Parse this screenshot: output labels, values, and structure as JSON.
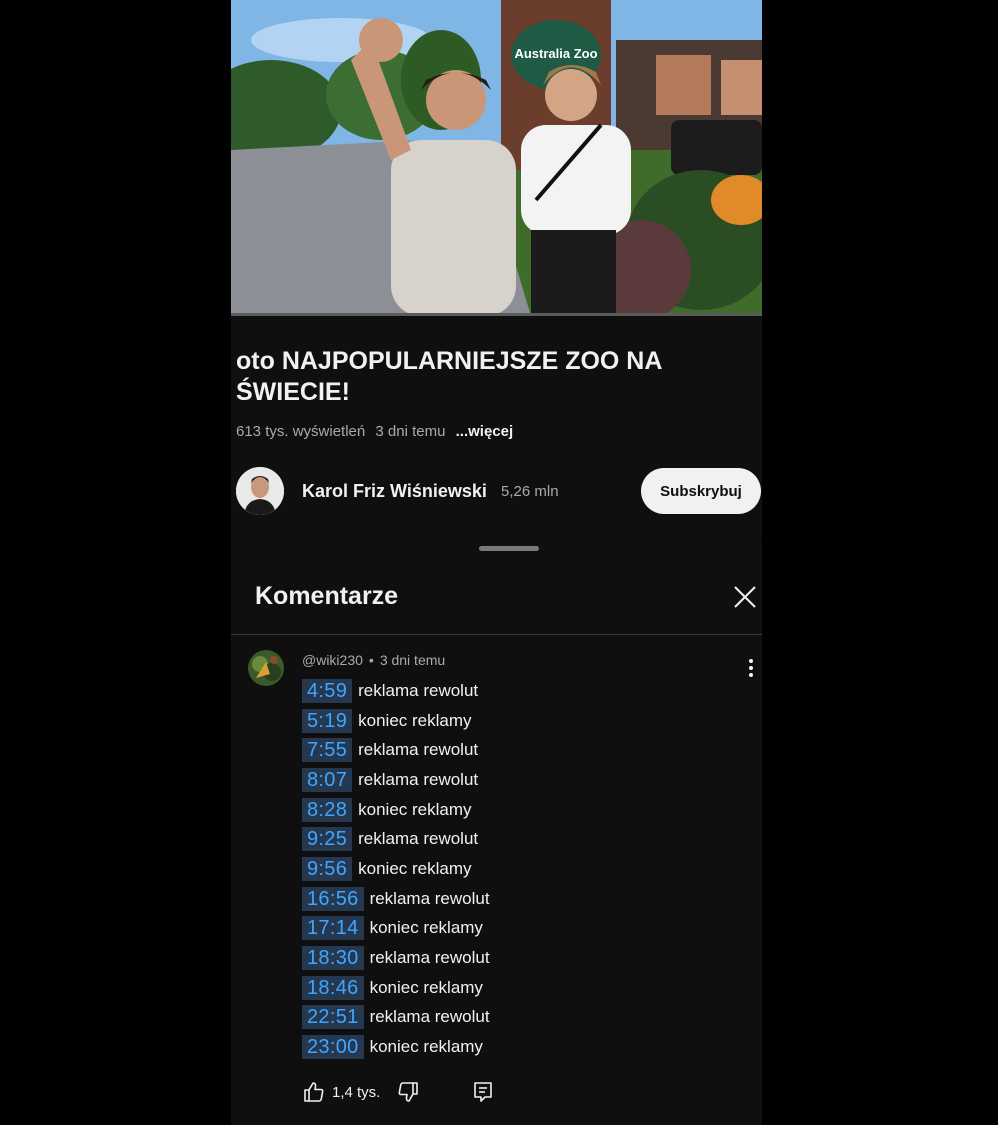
{
  "video": {
    "sign_text": "Australia Zoo",
    "progress_fraction": 0.0
  },
  "meta": {
    "title": "oto NAJPOPULARNIEJSZE ZOO NA ŚWIECIE!",
    "views": "613 tys. wyświetleń",
    "age": "3 dni temu",
    "more": "...więcej"
  },
  "channel": {
    "name": "Karol Friz Wiśniewski",
    "subscribers": "5,26 mln",
    "subscribe_label": "Subskrybuj"
  },
  "comments": {
    "heading": "Komentarze",
    "items": [
      {
        "author": "@wiki230",
        "separator": "•",
        "age": "3 dni temu",
        "lines": [
          {
            "time": "4:59",
            "text": "reklama rewolut"
          },
          {
            "time": "5:19",
            "text": "koniec reklamy"
          },
          {
            "time": "7:55",
            "text": "reklama rewolut"
          },
          {
            "time": "8:07",
            "text": "reklama rewolut"
          },
          {
            "time": "8:28",
            "text": "koniec reklamy"
          },
          {
            "time": "9:25",
            "text": "reklama rewolut"
          },
          {
            "time": "9:56",
            "text": "koniec reklamy"
          },
          {
            "time": "16:56",
            "text": "reklama rewolut"
          },
          {
            "time": "17:14",
            "text": "koniec reklamy"
          },
          {
            "time": "18:30",
            "text": "reklama rewolut"
          },
          {
            "time": "18:46",
            "text": "koniec reklamy"
          },
          {
            "time": "22:51",
            "text": "reklama rewolut"
          },
          {
            "time": "23:00",
            "text": "koniec reklamy"
          }
        ],
        "likes": "1,4 tys."
      }
    ]
  },
  "icons": {
    "close": "close-icon",
    "more": "more-vert-icon",
    "like": "thumb-up-icon",
    "dislike": "thumb-down-icon",
    "reply": "reply-icon"
  },
  "colors": {
    "background": "#0f0f0f",
    "timestamp_link": "#3ea6ff",
    "timestamp_bg": "#263850",
    "progress": "#ff0033"
  }
}
